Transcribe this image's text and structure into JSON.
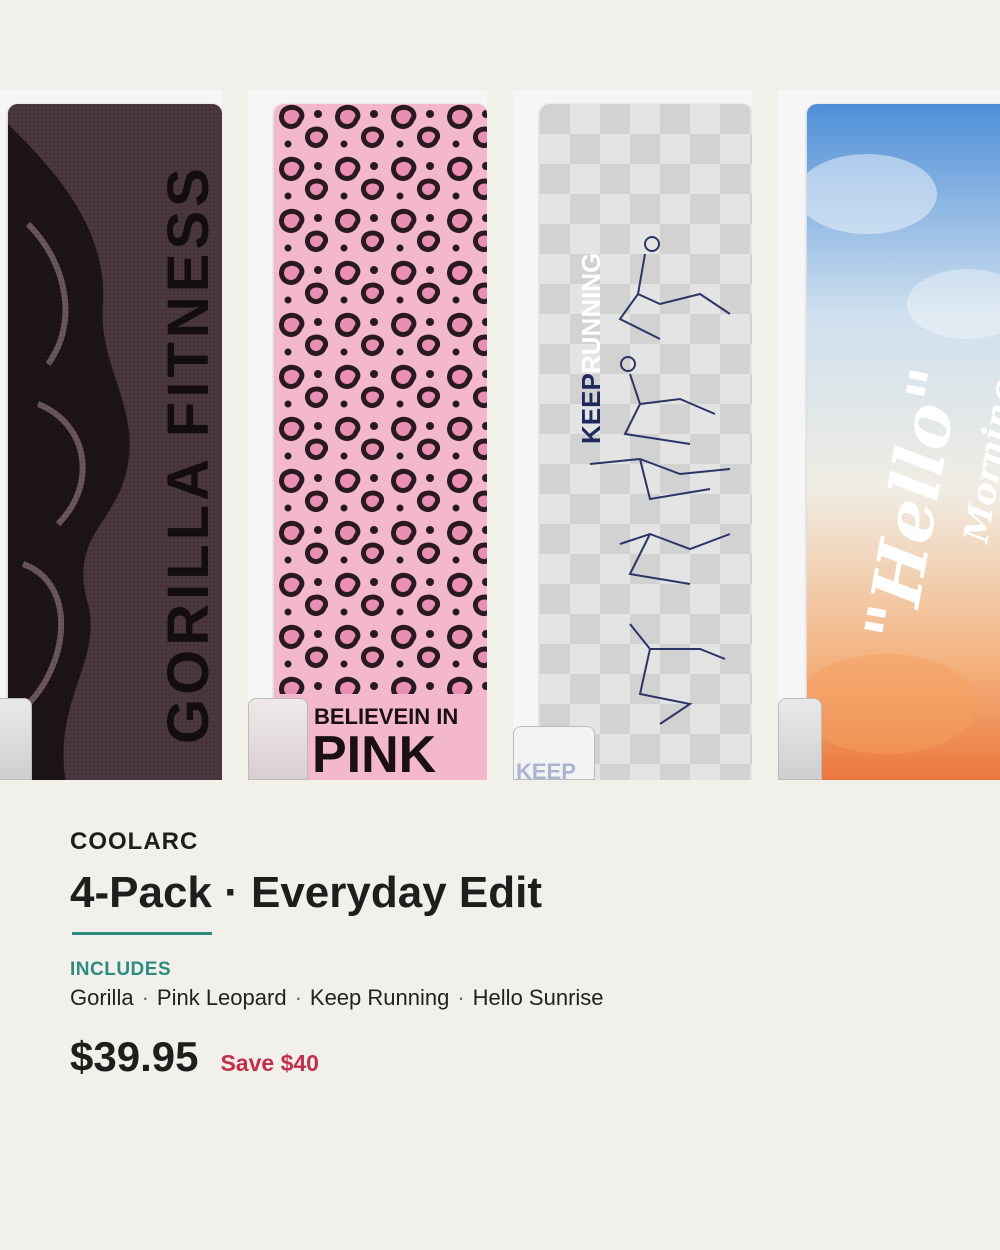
{
  "product": {
    "brand": "COOLARC",
    "title": "4-Pack · Everyday Edit",
    "includes_label": "INCLUDES",
    "includes": [
      "Gorilla",
      "Pink Leopard",
      "Keep Running",
      "Hello Sunrise"
    ],
    "price": "$39.95",
    "save": "Save $40"
  },
  "towels": [
    {
      "name": "Gorilla",
      "print_text": "GORILLA FITNESS",
      "color": "#3a2b31"
    },
    {
      "name": "Pink Leopard",
      "print_text_1": "BELIEVEIN IN",
      "print_text_2": "PINK",
      "color": "#f2b6c8"
    },
    {
      "name": "Keep Running",
      "print_text_a": "KEEP",
      "print_text_b": "RUNNING",
      "pouch_text": "KEEP",
      "color": "#dcdcdc"
    },
    {
      "name": "Hello Sunrise",
      "print_text_1": "\"Hello\"",
      "print_text_2": "Morning",
      "color": "#e88a4a"
    }
  ],
  "colors": {
    "accent": "#2e8b80",
    "sale": "#c0304a",
    "background": "#f2f0ea"
  }
}
